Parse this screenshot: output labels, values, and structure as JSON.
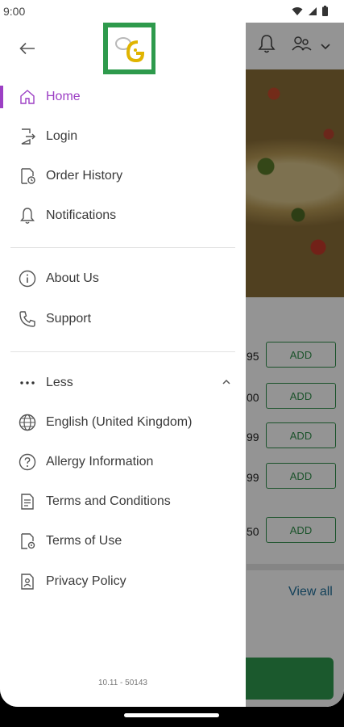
{
  "status_bar": {
    "time": "9:00",
    "icons": [
      "wifi-icon",
      "signal-icon",
      "battery-icon"
    ]
  },
  "background_app": {
    "price_fragments": [
      "95",
      "00",
      "99",
      "99",
      "50"
    ],
    "add_label": "ADD",
    "view_all": "View all"
  },
  "drawer": {
    "logo_alt": "G",
    "items": [
      {
        "label": "Home",
        "icon": "home-icon",
        "active": true
      },
      {
        "label": "Login",
        "icon": "login-icon"
      },
      {
        "label": "Order History",
        "icon": "order-history-icon"
      },
      {
        "label": "Notifications",
        "icon": "bell-icon"
      },
      {
        "label": "About Us",
        "icon": "info-icon"
      },
      {
        "label": "Support",
        "icon": "phone-icon"
      },
      {
        "label": "Less",
        "icon": "more-dots-icon"
      },
      {
        "label": "English (United Kingdom)",
        "icon": "globe-icon"
      },
      {
        "label": "Allergy Information",
        "icon": "question-icon"
      },
      {
        "label": "Terms and Conditions",
        "icon": "document-icon"
      },
      {
        "label": "Terms of Use",
        "icon": "document-gear-icon"
      },
      {
        "label": "Privacy Policy",
        "icon": "privacy-icon"
      }
    ],
    "version": "10.11 - 50143"
  },
  "colors": {
    "accent": "#9c3fc4",
    "brand_green": "#2e9a4c",
    "link_blue": "#1f6f9a"
  }
}
